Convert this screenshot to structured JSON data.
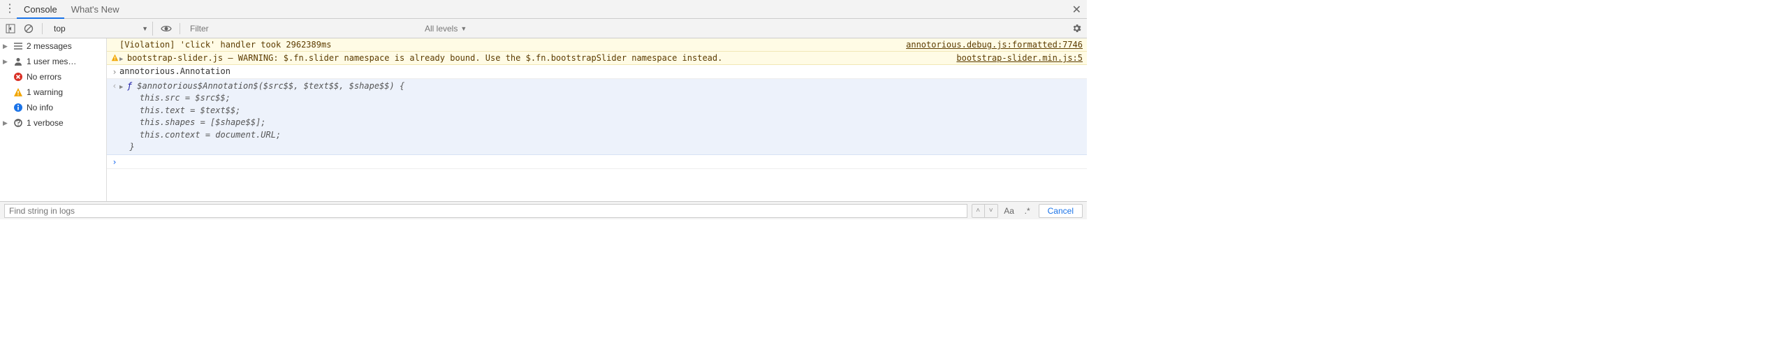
{
  "tabs": {
    "console": "Console",
    "whatsnew": "What's New"
  },
  "toolbar": {
    "context": "top",
    "filter_placeholder": "Filter",
    "levels": "All levels"
  },
  "sidebar": {
    "messages": {
      "count": "2",
      "label": "messages"
    },
    "user": {
      "count": "1",
      "label": "user mes…"
    },
    "errors": {
      "label": "No errors"
    },
    "warnings": {
      "count": "1",
      "label": "warning"
    },
    "info": {
      "label": "No info"
    },
    "verbose": {
      "count": "1",
      "label": "verbose"
    }
  },
  "log": {
    "violation": {
      "text": "[Violation] 'click' handler took 2962389ms",
      "source": "annotorious.debug.js:formatted:7746"
    },
    "warning": {
      "text": "bootstrap-slider.js – WARNING: $.fn.slider namespace is already bound. Use the $.fn.bootstrapSlider namespace instead.",
      "source": "bootstrap-slider.min.js:5"
    },
    "input": {
      "text": "annotorious.Annotation"
    },
    "output": {
      "sig_prefix": "ƒ ",
      "sig": "$annotorious$Annotation$($src$$, $text$$, $shape$$) {",
      "line1": "    this.src = $src$$;",
      "line2": "    this.text = $text$$;",
      "line3": "    this.shapes = [$shape$$];",
      "line4": "    this.context = document.URL;",
      "line5": "  }"
    }
  },
  "findbar": {
    "placeholder": "Find string in logs",
    "match_case": "Aa",
    "regex": ".*",
    "cancel": "Cancel"
  }
}
